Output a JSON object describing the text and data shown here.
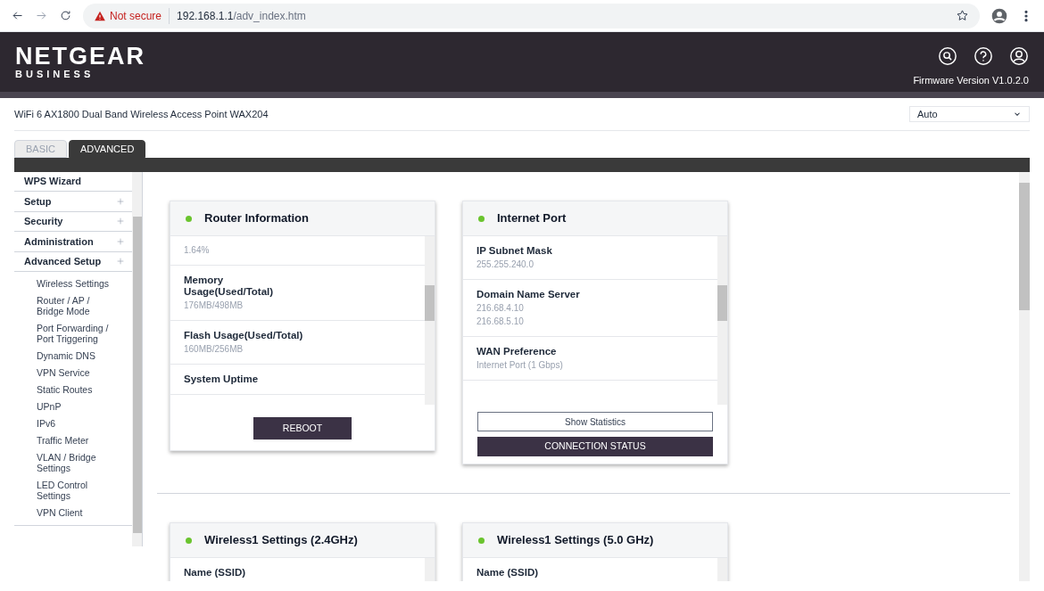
{
  "browser": {
    "security": "Not secure",
    "url_host": "192.168.1.1",
    "url_path": "/adv_index.htm"
  },
  "header": {
    "brand": "NETGEAR",
    "subbrand": "BUSINESS",
    "firmware": "Firmware Version V1.0.2.0"
  },
  "device": {
    "model": "WiFi 6 AX1800 Dual Band Wireless Access Point WAX204",
    "mode_select": "Auto"
  },
  "tabs": [
    {
      "label": "BASIC",
      "selected": false
    },
    {
      "label": "ADVANCED",
      "selected": true
    }
  ],
  "sidebar": {
    "items": [
      {
        "label": "WPS Wizard",
        "expandable": false
      },
      {
        "label": "Setup",
        "expandable": true
      },
      {
        "label": "Security",
        "expandable": true
      },
      {
        "label": "Administration",
        "expandable": true
      },
      {
        "label": "Advanced Setup",
        "expandable": true,
        "children": [
          {
            "label": "Wireless Settings"
          },
          {
            "label": "Router / AP / Bridge Mode"
          },
          {
            "label": "Port Forwarding / Port Triggering"
          },
          {
            "label": "Dynamic DNS"
          },
          {
            "label": "VPN Service"
          },
          {
            "label": "Static Routes"
          },
          {
            "label": "UPnP"
          },
          {
            "label": "IPv6"
          },
          {
            "label": "Traffic Meter"
          },
          {
            "label": "VLAN / Bridge Settings"
          },
          {
            "label": "LED Control Settings"
          },
          {
            "label": "VPN Client"
          }
        ]
      }
    ]
  },
  "cards": [
    {
      "title": "Router Information",
      "fields": [
        {
          "values": [
            "1.64%"
          ]
        },
        {
          "label": "Memory Usage(Used/Total)",
          "values": [
            "176MB/498MB"
          ]
        },
        {
          "label": "Flash Usage(Used/Total)",
          "values": [
            "160MB/256MB"
          ]
        },
        {
          "label": "System Uptime"
        }
      ],
      "buttons": [
        {
          "label": "REBOOT",
          "kind": "primary"
        }
      ]
    },
    {
      "title": "Internet Port",
      "fields": [
        {
          "label": "IP Subnet Mask",
          "values": [
            "255.255.240.0"
          ]
        },
        {
          "label": "Domain Name Server",
          "values": [
            "216.68.4.10",
            "216.68.5.10"
          ]
        },
        {
          "label": "WAN Preference",
          "values": [
            "Internet Port (1 Gbps)"
          ]
        }
      ],
      "buttons": [
        {
          "label": "Show Statistics",
          "kind": "outline"
        },
        {
          "label": "CONNECTION STATUS",
          "kind": "wide"
        }
      ]
    },
    {
      "title": "Wireless1 Settings (2.4GHz)",
      "fields": [
        {
          "label": "Name (SSID)"
        }
      ]
    },
    {
      "title": "Wireless1 Settings (5.0 GHz)",
      "fields": [
        {
          "label": "Name (SSID)"
        }
      ]
    }
  ]
}
